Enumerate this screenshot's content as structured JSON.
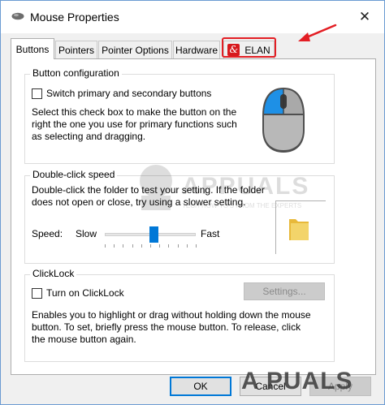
{
  "window": {
    "title": "Mouse Properties",
    "close_glyph": "✕"
  },
  "tabs": [
    {
      "label": "Buttons",
      "active": true
    },
    {
      "label": "Pointers",
      "active": false
    },
    {
      "label": "Pointer Options",
      "active": false
    },
    {
      "label": "Hardware",
      "active": false
    },
    {
      "label": "ELAN",
      "active": false,
      "icon": "elan-logo-icon"
    }
  ],
  "button_config": {
    "title": "Button configuration",
    "checkbox_label": "Switch primary and secondary buttons",
    "checked": false,
    "description": "Select this check box to make the button on the right the one you use for primary functions such as selecting and dragging."
  },
  "double_click": {
    "title": "Double-click speed",
    "description": "Double-click the folder to test your setting. If the folder does not open or close, try using a slower setting.",
    "speed_label": "Speed:",
    "slow_label": "Slow",
    "fast_label": "Fast",
    "speed_value_fraction": 0.54
  },
  "clicklock": {
    "title": "ClickLock",
    "checkbox_label": "Turn on ClickLock",
    "checked": false,
    "settings_label": "Settings...",
    "description": "Enables you to highlight or drag without holding down the mouse button. To set, briefly press the mouse button. To release, click the mouse button again."
  },
  "footer": {
    "ok_label": "OK",
    "cancel_label": "Cancel",
    "apply_label": "Apply"
  },
  "watermark": {
    "text_center": "APPUALS",
    "tagline": "TECH HOW-TO'S FROM THE EXPERTS",
    "text_bottom": "A PUALS"
  },
  "colors": {
    "accent": "#0078d7",
    "highlight_red": "#e31e24",
    "mouse_blue": "#1e90e6",
    "folder_yellow": "#f3d46a"
  }
}
